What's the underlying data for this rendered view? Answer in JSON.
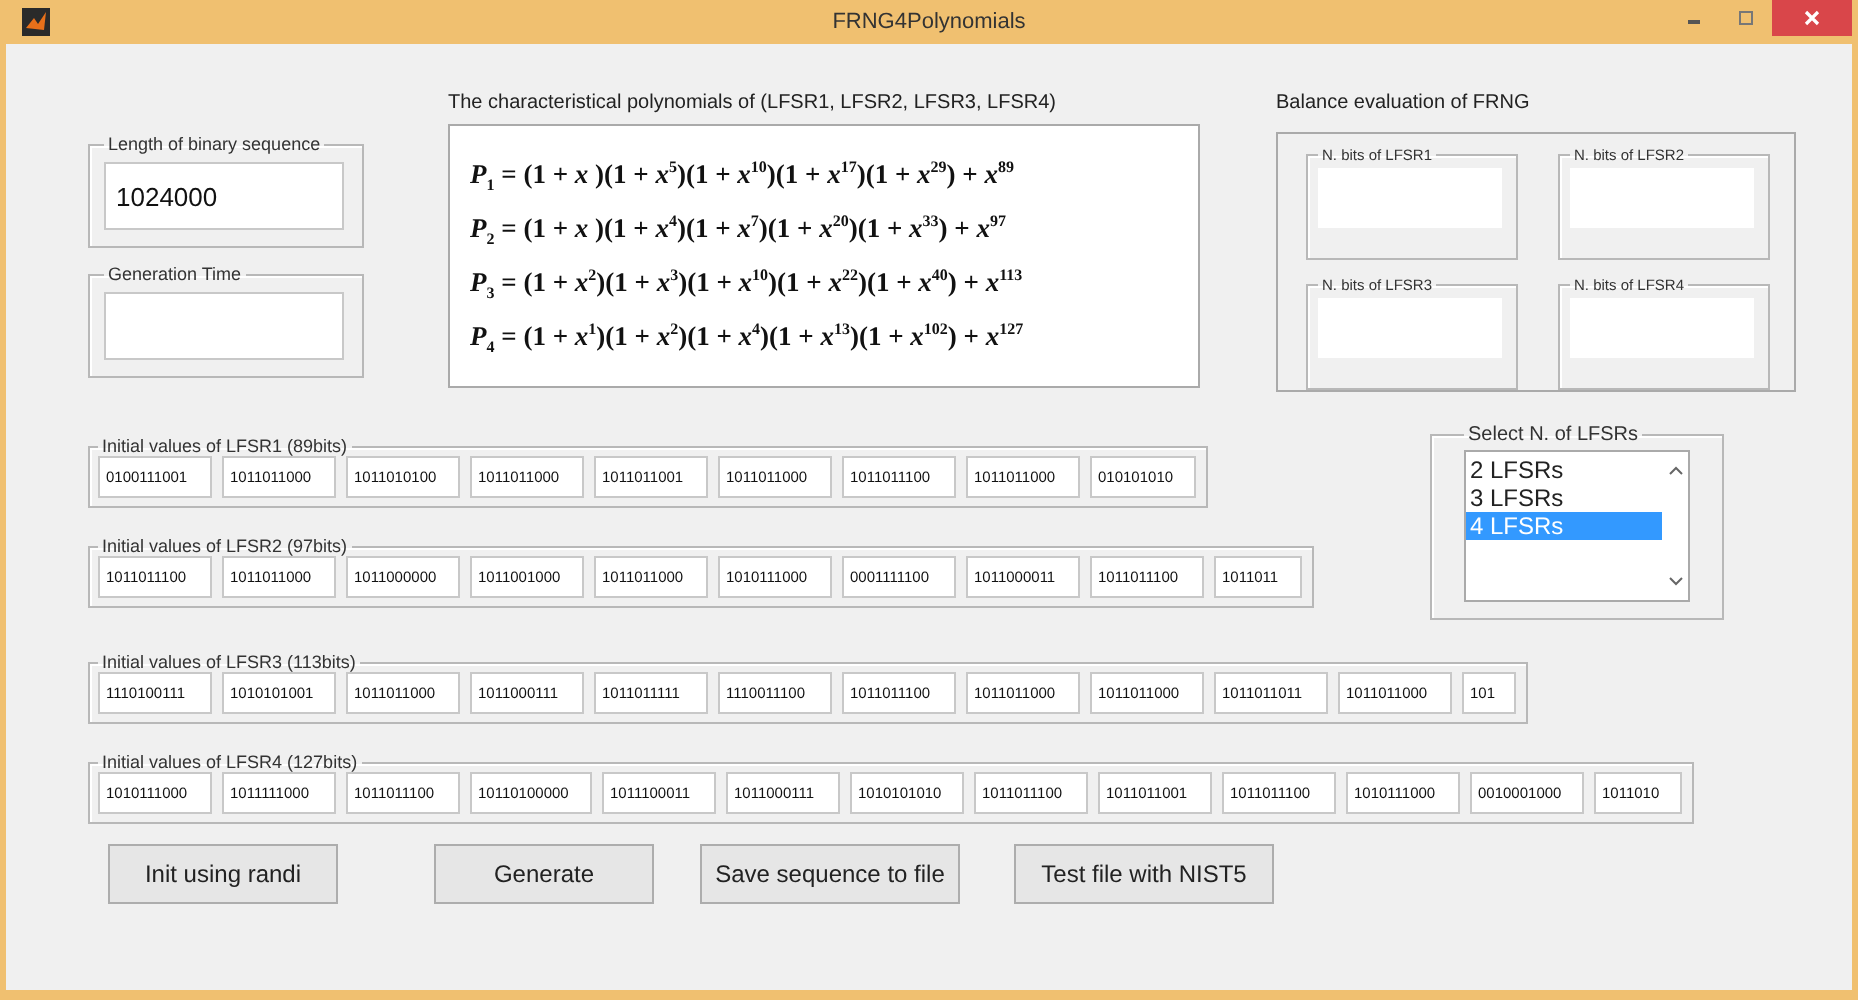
{
  "window": {
    "title": "FRNG4Polynomials"
  },
  "length_group": {
    "label": "Length of binary sequence",
    "value": "1024000"
  },
  "generation_time": {
    "label": "Generation Time"
  },
  "polynomials": {
    "title": "The characteristical polynomials of (LFSR1, LFSR2, LFSR3, LFSR4)",
    "lines": [
      "*P*$_{1}$ = (1 + *x* )(1 + *x*$^{5}$)(1 + *x*$^{10}$)(1 + *x*$^{17}$)(1 + *x*$^{29}$) + *x*$^{89}$",
      "*P*$_{2}$ =  (1 + *x* )(1 + *x*$^{4}$)(1 + *x*$^{7}$)(1 + *x*$^{20}$)(1 + *x*$^{33}$) + *x*$^{97}$",
      "*P*$_{3}$ = (1 + *x*$^{2}$)(1 + *x*$^{3}$)(1 + *x*$^{10}$)(1 + *x*$^{22}$)(1 + *x*$^{40}$) + *x*$^{113}$",
      "*P*$_{4}$ = (1 + *x*$^{1}$)(1 + *x*$^{2}$)(1 + *x*$^{4}$)(1 + *x*$^{13}$)(1 + *x*$^{102}$) + *x*$^{127}$"
    ]
  },
  "balance": {
    "title": "Balance evaluation of FRNG",
    "groups": [
      "N. bits of LFSR1",
      "N. bits of LFSR2",
      "N. bits of LFSR3",
      "N. bits of LFSR4"
    ]
  },
  "lfsr_groups": [
    {
      "label": "Initial values of LFSR1 (89bits)",
      "cells": [
        "0100111001",
        "1011011000",
        "1011010100",
        "1011011000",
        "1011011001",
        "1011011000",
        "1011011100",
        "1011011000",
        "010101010"
      ]
    },
    {
      "label": "Initial values of LFSR2 (97bits)",
      "cells": [
        "1011011100",
        "1011011000",
        "1011000000",
        "1011001000",
        "1011011000",
        "1010111000",
        "0001111100",
        "1011000011",
        "1011011100",
        "1011011"
      ]
    },
    {
      "label": "Initial values of LFSR3 (113bits)",
      "cells": [
        "1110100111",
        "1010101001",
        "1011011000",
        "1011000111",
        "1011011111",
        "1110011100",
        "1011011100",
        "1011011000",
        "1011011000",
        "1011011011",
        "1011011000",
        "101"
      ]
    },
    {
      "label": "Initial values of LFSR4 (127bits)",
      "cells": [
        "1010111000",
        "1011111000",
        "1011011100",
        "10110100000",
        "1011100011",
        "1011000111",
        "1010101010",
        "1011011100",
        "1011011001",
        "1011011100",
        "1010111000",
        "0010001000",
        "1011010"
      ]
    }
  ],
  "select": {
    "label": "Select N. of LFSRs",
    "options": [
      {
        "label": "2 LFSRs",
        "selected": false
      },
      {
        "label": "3 LFSRs",
        "selected": false
      },
      {
        "label": "4 LFSRs",
        "selected": true
      }
    ]
  },
  "buttons": [
    "Init using randi",
    "Generate",
    "Save sequence to file",
    "Test file with NIST5"
  ]
}
